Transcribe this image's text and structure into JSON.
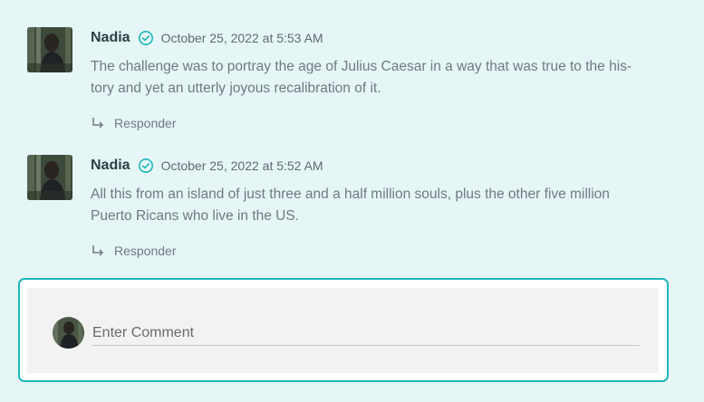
{
  "comments": [
    {
      "author": "Nadia",
      "date": "October 25, 2022 at 5:53 AM",
      "text": "The challenge was to portray the age of Julius Caesar in a way that was true to the his-tory and yet an utterly joyous recalibration of it.",
      "reply_label": "Responder"
    },
    {
      "author": "Nadia",
      "date": "October 25, 2022 at 5:52 AM",
      "text": "All this from an island of just three and a half million souls, plus the other five million Puerto Ricans who live in the US.",
      "reply_label": "Responder"
    }
  ],
  "comment_form": {
    "placeholder": "Enter Comment"
  },
  "icons": {
    "verified": "check-circle-icon",
    "reply": "reply-arrow-icon"
  },
  "colors": {
    "background": "#e6f6f7",
    "accent": "#1fb5bd",
    "author": "#2f3e44",
    "text": "#6e7a7f"
  }
}
